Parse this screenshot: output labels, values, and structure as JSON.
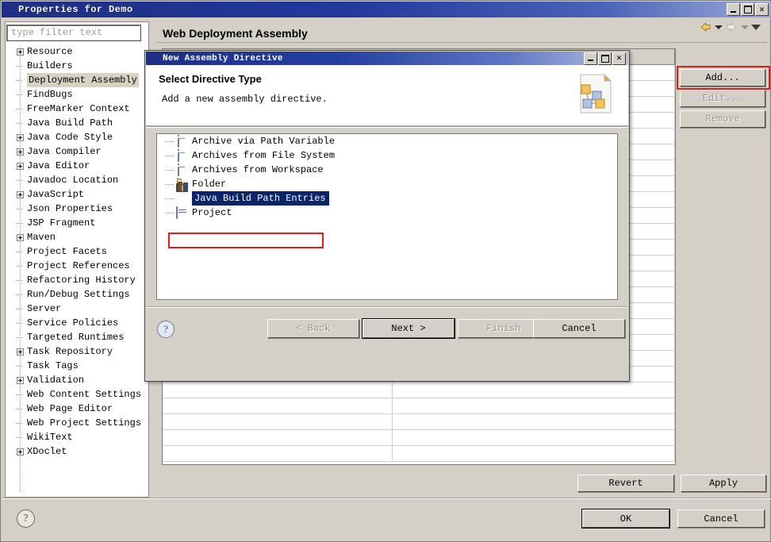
{
  "window": {
    "title": "Properties for Demo",
    "icon": "gear-icon",
    "controls": {
      "minimize": "_",
      "maximize": "□",
      "close": "✕"
    }
  },
  "sidebar": {
    "filter_placeholder": "type filter text",
    "filter_value": "",
    "selected": "Deployment Assembly",
    "items": [
      {
        "label": "Resource",
        "expandable": true
      },
      {
        "label": "Builders",
        "expandable": false
      },
      {
        "label": "Deployment Assembly",
        "expandable": false
      },
      {
        "label": "FindBugs",
        "expandable": false
      },
      {
        "label": "FreeMarker Context",
        "expandable": false
      },
      {
        "label": "Java Build Path",
        "expandable": false
      },
      {
        "label": "Java Code Style",
        "expandable": true
      },
      {
        "label": "Java Compiler",
        "expandable": true
      },
      {
        "label": "Java Editor",
        "expandable": true
      },
      {
        "label": "Javadoc Location",
        "expandable": false
      },
      {
        "label": "JavaScript",
        "expandable": true
      },
      {
        "label": "Json Properties",
        "expandable": false
      },
      {
        "label": "JSP Fragment",
        "expandable": false
      },
      {
        "label": "Maven",
        "expandable": true
      },
      {
        "label": "Project Facets",
        "expandable": false
      },
      {
        "label": "Project References",
        "expandable": false
      },
      {
        "label": "Refactoring History",
        "expandable": false
      },
      {
        "label": "Run/Debug Settings",
        "expandable": false
      },
      {
        "label": "Server",
        "expandable": false
      },
      {
        "label": "Service Policies",
        "expandable": false
      },
      {
        "label": "Targeted Runtimes",
        "expandable": false
      },
      {
        "label": "Task Repository",
        "expandable": true
      },
      {
        "label": "Task Tags",
        "expandable": false
      },
      {
        "label": "Validation",
        "expandable": true
      },
      {
        "label": "Web Content Settings",
        "expandable": false
      },
      {
        "label": "Web Page Editor",
        "expandable": false
      },
      {
        "label": "Web Project Settings",
        "expandable": false
      },
      {
        "label": "WikiText",
        "expandable": false
      },
      {
        "label": "XDoclet",
        "expandable": true
      }
    ]
  },
  "page": {
    "title": "Web Deployment Assembly",
    "nav": {
      "back_icon": "back-arrow-icon",
      "forward_icon": "forward-arrow-icon",
      "dropdown_icon": "chevron-down-icon"
    },
    "table": {
      "columns": [
        "",
        ""
      ],
      "rows": [],
      "row_count": 25
    },
    "side_buttons": [
      {
        "label": "Add...",
        "enabled": true,
        "highlighted": true
      },
      {
        "label": "Edit...",
        "enabled": false,
        "highlighted": false
      },
      {
        "label": "Remove",
        "enabled": false,
        "highlighted": false
      }
    ],
    "revert_label": "Revert",
    "apply_label": "Apply"
  },
  "footer": {
    "help_icon": "question-mark-icon",
    "ok_label": "OK",
    "cancel_label": "Cancel"
  },
  "wizard": {
    "title": "New Assembly Directive",
    "icon": "gear-icon",
    "controls": {
      "minimize": "_",
      "maximize": "□",
      "close": "✕"
    },
    "heading": "Select Directive Type",
    "description": "Add a new assembly directive.",
    "banner_icon": "assembly-page-icon",
    "help_icon": "question-mark-icon",
    "selected_item": "Java Build Path Entries",
    "items": [
      {
        "label": "Archive via Path Variable",
        "icon": "jar-icon",
        "selected": false
      },
      {
        "label": "Archives from File System",
        "icon": "jar-icon",
        "selected": false
      },
      {
        "label": "Archives from Workspace",
        "icon": "jar-icon",
        "selected": false
      },
      {
        "label": "Folder",
        "icon": "folder-icon",
        "selected": false
      },
      {
        "label": "Java Build Path Entries",
        "icon": "books-icon",
        "selected": true
      },
      {
        "label": "Project",
        "icon": "project-icon",
        "selected": false
      }
    ],
    "buttons": [
      {
        "label": "< Back",
        "enabled": false,
        "default": false
      },
      {
        "label": "Next >",
        "enabled": true,
        "default": true
      },
      {
        "label": "Finish",
        "enabled": false,
        "default": false
      },
      {
        "label": "Cancel",
        "enabled": true,
        "default": false
      }
    ]
  },
  "colors": {
    "highlight_red": "#e51c1c",
    "selection_blue": "#0a246a",
    "titlebar_blue": "#1d2f85",
    "dialog_face": "#d4d0c8"
  }
}
